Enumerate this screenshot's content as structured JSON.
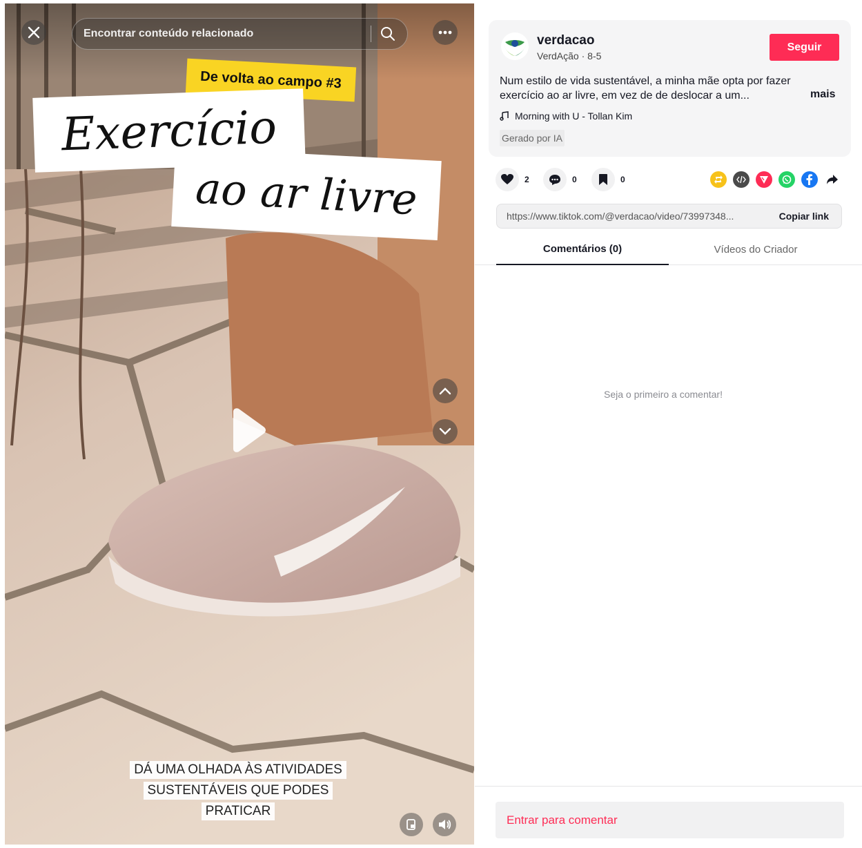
{
  "video": {
    "search_placeholder": "Encontrar conteúdo relacionado",
    "tag": "De volta ao campo #3",
    "title_line1": "Exercício",
    "title_line2": "ao ar livre",
    "caption_lines": [
      "DÁ UMA OLHADA ÀS ATIVIDADES",
      "SUSTENTÁVEIS QUE PODES",
      "PRATICAR"
    ],
    "icons": {
      "close": "close-icon",
      "more": "more-icon",
      "search": "search-icon",
      "play": "play-icon",
      "up": "chevron-up-icon",
      "down": "chevron-down-icon",
      "pip": "picture-in-picture-icon",
      "volume": "volume-icon"
    }
  },
  "post": {
    "username": "verdacao",
    "display_name": "VerdAção",
    "date": "8-5",
    "subline": "VerdAção · 8-5",
    "follow_label": "Seguir",
    "description": "Num estilo de vida sustentável, a minha mãe opta por fazer exercício ao ar livre, em vez de de deslocar a um...",
    "more_label": "mais",
    "music": "Morning with U - Tollan Kim",
    "ai_label": "Gerado por IA"
  },
  "actions": {
    "likes": "2",
    "comments": "0",
    "saves": "0"
  },
  "share": {
    "link_url": "https://www.tiktok.com/@verdacao/video/73997348...",
    "copy_label": "Copiar link",
    "colors": {
      "repost": "#f7c21a",
      "embed": "#4a4a4a",
      "send": "#fe2c55",
      "whatsapp": "#25d366",
      "facebook": "#1877f2"
    }
  },
  "tabs": {
    "comments": "Comentários (0)",
    "creator_videos": "Vídeos do Criador"
  },
  "comments": {
    "empty_message": "Seja o primeiro a comentar!",
    "login_prompt": "Entrar para comentar"
  },
  "colors": {
    "accent": "#fe2c55",
    "tag_yellow": "#f9d423"
  }
}
